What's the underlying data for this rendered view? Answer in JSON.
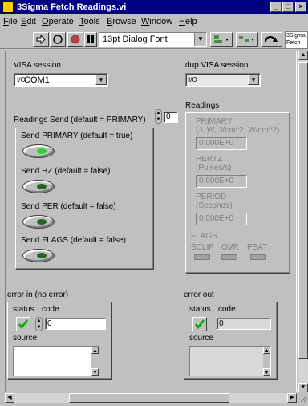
{
  "window": {
    "title": "3Sigma Fetch Readings.vi"
  },
  "menu": [
    {
      "pre": "",
      "u": "F",
      "post": "ile"
    },
    {
      "pre": "",
      "u": "E",
      "post": "dit"
    },
    {
      "pre": "",
      "u": "O",
      "post": "perate"
    },
    {
      "pre": "",
      "u": "T",
      "post": "ools"
    },
    {
      "pre": "",
      "u": "B",
      "post": "rowse"
    },
    {
      "pre": "",
      "u": "W",
      "post": "indow"
    },
    {
      "pre": "",
      "u": "H",
      "post": "elp"
    }
  ],
  "toolbar": {
    "font": "13pt Dialog Font",
    "mini_line1": "3Sigma",
    "mini_line2": "Fetch"
  },
  "controls": {
    "visa_label": "VISA session",
    "visa_prefix": "I/O",
    "visa_value": "COM1",
    "dup_visa_label": "dup VISA session",
    "dup_visa_prefix": "I/O",
    "dup_visa_value": "",
    "readings_send_label": "Readings Send (default = PRIMARY)",
    "readings_send_value": "0",
    "send_primary_label": "Send PRIMARY (default = true)",
    "send_hz_label": "Send HZ (default = false)",
    "send_per_label": "Send PER (default = false)",
    "send_flags_label": "Send FLAGS (default = false)",
    "send_primary_on": true,
    "send_hz_on": false,
    "send_per_on": false,
    "send_flags_on": false
  },
  "readings": {
    "title": "Readings",
    "primary_label": "PRIMARY",
    "primary_units": "(J, W, J/cm^2, W/cm^2)",
    "primary_value": "0.000E+0",
    "hertz_label": "HERTZ",
    "hertz_units": "(Pulses/s)",
    "hertz_value": "0.000E+0",
    "period_label": "PERIOD",
    "period_units": "(Seconds)",
    "period_value": "0.000E+0",
    "flags_label": "FLAGS",
    "flags": [
      "BCLIP",
      "OVR",
      "PSAT"
    ]
  },
  "error_in": {
    "title": "error in (no error)",
    "status_label": "status",
    "code_label": "code",
    "code_value": "0",
    "source_label": "source",
    "source_value": ""
  },
  "error_out": {
    "title": "error out",
    "status_label": "status",
    "code_label": "code",
    "code_value": "0",
    "source_label": "source",
    "source_value": ""
  },
  "colors": {
    "led_on": "#33cc33",
    "led_off": "#226622",
    "check": "#00aa00",
    "title_bar": "#000080"
  },
  "icons": [
    "run-arrow-icon",
    "run-continuous-icon",
    "abort-icon",
    "pause-icon",
    "align-icon",
    "distribute-icon",
    "reorder-icon"
  ]
}
